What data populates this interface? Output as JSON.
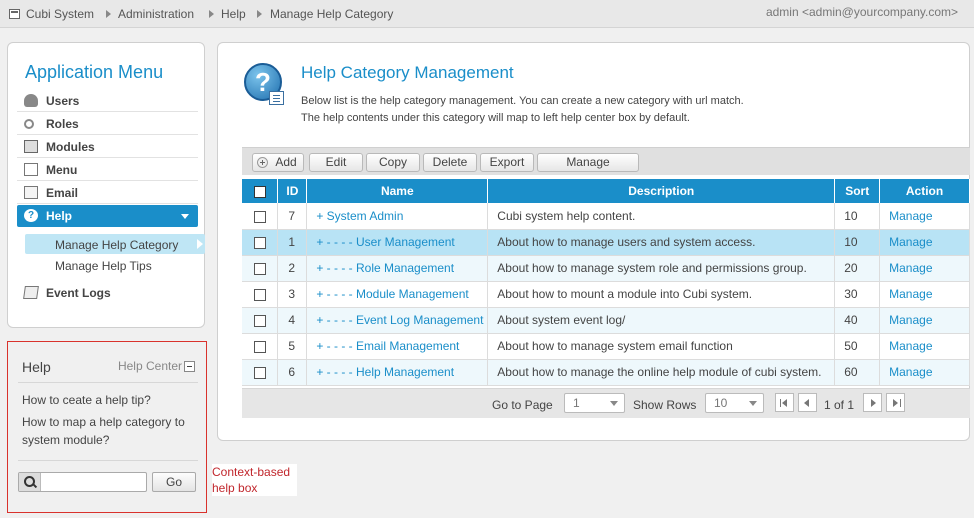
{
  "breadcrumb": [
    "Cubi System",
    "Administration",
    "Help",
    "Manage Help Category"
  ],
  "user_label": "admin <admin@yourcompany.com>",
  "colors": {
    "accent": "#1a8ec9",
    "highlight_row": "#b8e3f5",
    "annotation": "#c1272d"
  },
  "sidebar": {
    "title": "Application Menu",
    "items": [
      {
        "label": "Users",
        "icon": "users-icon"
      },
      {
        "label": "Roles",
        "icon": "key-icon"
      },
      {
        "label": "Modules",
        "icon": "modules-icon"
      },
      {
        "label": "Menu",
        "icon": "menu-icon"
      },
      {
        "label": "Email",
        "icon": "email-icon"
      },
      {
        "label": "Help",
        "icon": "help-icon",
        "active": true
      },
      {
        "label": "Event Logs",
        "icon": "event-logs-icon"
      }
    ],
    "subitems": [
      {
        "label": "Manage Help Category",
        "active": true
      },
      {
        "label": "Manage Help Tips"
      }
    ]
  },
  "help_box": {
    "title": "Help",
    "center_link": "Help Center",
    "links": [
      "How to ceate a help tip?",
      "How to map a help category to system module?"
    ],
    "search_value": "",
    "go_label": "Go"
  },
  "annotation": "Context-based help box",
  "main": {
    "title": "Help Category Management",
    "description": [
      "Below list is the help category management. You can create a new category with url match.",
      "The help contents under this category will map to left help center box by default."
    ],
    "toolbar": [
      "Add",
      "Edit",
      "Copy",
      "Delete",
      "Export",
      "Manage"
    ],
    "columns": [
      "ID",
      "Name",
      "Description",
      "Sort",
      "Action"
    ],
    "rows": [
      {
        "id": "7",
        "name": "+ System Admin",
        "description": "Cubi system help content.",
        "sort": "10",
        "action": "Manage"
      },
      {
        "id": "1",
        "name": "+ - - - - User Management",
        "description": "About how to manage users and system access.",
        "sort": "10",
        "action": "Manage",
        "selected": true
      },
      {
        "id": "2",
        "name": "+ - - - - Role Management",
        "description": "About how to manage system role and permissions group.",
        "sort": "20",
        "action": "Manage"
      },
      {
        "id": "3",
        "name": "+ - - - - Module Management",
        "description": "About how to mount a module into Cubi system.",
        "sort": "30",
        "action": "Manage"
      },
      {
        "id": "4",
        "name": "+ - - - - Event Log Management",
        "description": "About system event log/",
        "sort": "40",
        "action": "Manage"
      },
      {
        "id": "5",
        "name": "+ - - - - Email Management",
        "description": "About how to manage system email function",
        "sort": "50",
        "action": "Manage"
      },
      {
        "id": "6",
        "name": "+ - - - - Help Management",
        "description": "About how to manage the online help module of cubi system.",
        "sort": "60",
        "action": "Manage"
      }
    ],
    "pager": {
      "goto_label": "Go to Page",
      "page_value": "1",
      "rows_label": "Show Rows",
      "rows_value": "10",
      "page_info": "1 of 1"
    }
  }
}
